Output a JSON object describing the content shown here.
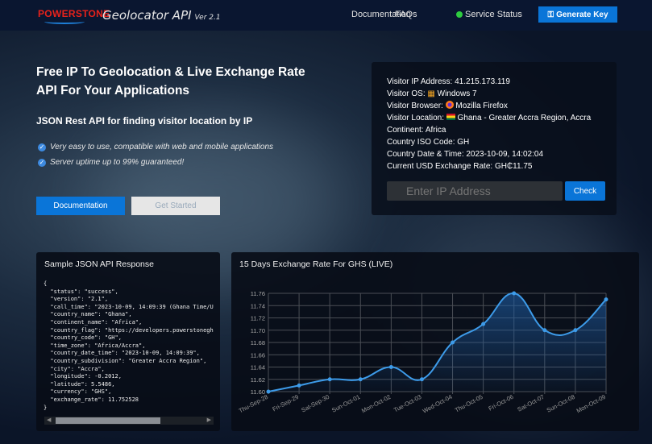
{
  "header": {
    "logo": "POWERSTONE",
    "title": "Geolocator API",
    "version": "Ver 2.1",
    "nav": [
      "Documentation",
      "FAQs",
      "Service Status"
    ],
    "generate_key": "Generate Key"
  },
  "hero": {
    "title": "Free IP To Geolocation & Live Exchange Rate API For Your Applications",
    "subtitle": "JSON Rest API for finding visitor location by IP",
    "features": [
      "Very easy to use, compatible with web and mobile applications",
      "Server uptime up to 99% guaranteed!"
    ],
    "btn_docs": "Documentation",
    "btn_start": "Get Started"
  },
  "info": {
    "lines": [
      "Visitor IP Address: 41.215.173.119",
      "Visitor OS: ",
      "Visitor Browser: ",
      "Visitor Location: ",
      "Continent: Africa",
      "Country ISO Code: GH",
      "Country Date & Time: 2023-10-09, 14:02:04",
      "Current USD Exchange Rate: GH₵11.75"
    ],
    "os": "Windows 7",
    "browser": "Mozilla Firefox",
    "location": "Ghana - Greater Accra Region, Accra",
    "ip_placeholder": "Enter IP Address",
    "check": "Check"
  },
  "json_panel": {
    "title": "Sample JSON API Response",
    "code": "{\n  \"status\": \"success\",\n  \"version\": \"2.1\",\n  \"call_time\": \"2023-10-09, 14:09:39 (Ghana Time/U\n  \"country_name\": \"Ghana\",\n  \"continent_name\": \"Africa\",\n  \"country_flag\": \"https://developers.powerstonegh\n  \"country_code\": \"GH\",\n  \"time_zone\": \"Africa/Accra\",\n  \"country_date_time\": \"2023-10-09, 14:09:39\",\n  \"country_subdivision\": \"Greater Accra Region\",\n  \"city\": \"Accra\",\n  \"longitude\": -0.2012,\n  \"latitude\": 5.5486,\n  \"currency\": \"GHS\",\n  \"exchange_rate\": 11.752528\n}"
  },
  "chart_data": {
    "type": "line",
    "title": "15 Days Exchange Rate For GHS (LIVE)",
    "categories": [
      "Thu-Sep-28",
      "Fri-Sep-29",
      "Sat-Sep-30",
      "Sun-Oct-01",
      "Mon-Oct-02",
      "Tue-Oct-03",
      "Wed-Oct-04",
      "Thu-Oct-05",
      "Fri-Oct-06",
      "Sat-Oct-07",
      "Sun-Oct-08",
      "Mon-Oct-09"
    ],
    "values": [
      11.6,
      11.61,
      11.62,
      11.62,
      11.64,
      11.62,
      11.68,
      11.71,
      11.76,
      11.7,
      11.7,
      11.75
    ],
    "yticks": [
      "11.60",
      "11.62",
      "11.64",
      "11.66",
      "11.68",
      "11.70",
      "11.72",
      "11.74",
      "11.76"
    ],
    "ylim": [
      11.6,
      11.76
    ],
    "grid": true,
    "color": "#3d9be9"
  }
}
